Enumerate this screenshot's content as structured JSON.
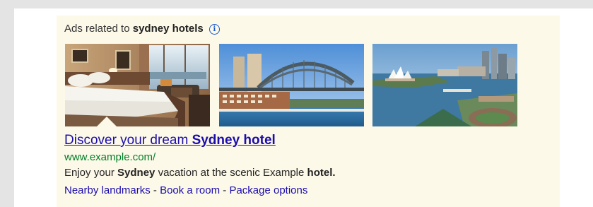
{
  "header": {
    "prefix": "Ads related to ",
    "query": "sydney hotels",
    "info_icon_glyph": "i",
    "info_icon_name": "info-icon"
  },
  "images": [
    {
      "name": "hotel-room-image",
      "selected": true
    },
    {
      "name": "harbour-bridge-image",
      "selected": false
    },
    {
      "name": "opera-house-harbour-image",
      "selected": false
    }
  ],
  "ad": {
    "title_prefix": "Discover your dream ",
    "title_emphasis": "Sydney hotel",
    "display_url": "www.example.com/",
    "description": {
      "part1": "Enjoy your ",
      "bold1": "Sydney",
      "part2": " vacation at the scenic Example ",
      "bold2": "hotel."
    },
    "sitelinks": [
      "Nearby landmarks",
      "Book a room",
      "Package options"
    ],
    "sitelink_separator": " - "
  },
  "colors": {
    "panel_background": "#fdf9e8",
    "link": "#1a0dab",
    "url": "#00802a",
    "info_icon": "#1a58c9",
    "outer_frame": "#e4e4e4"
  }
}
